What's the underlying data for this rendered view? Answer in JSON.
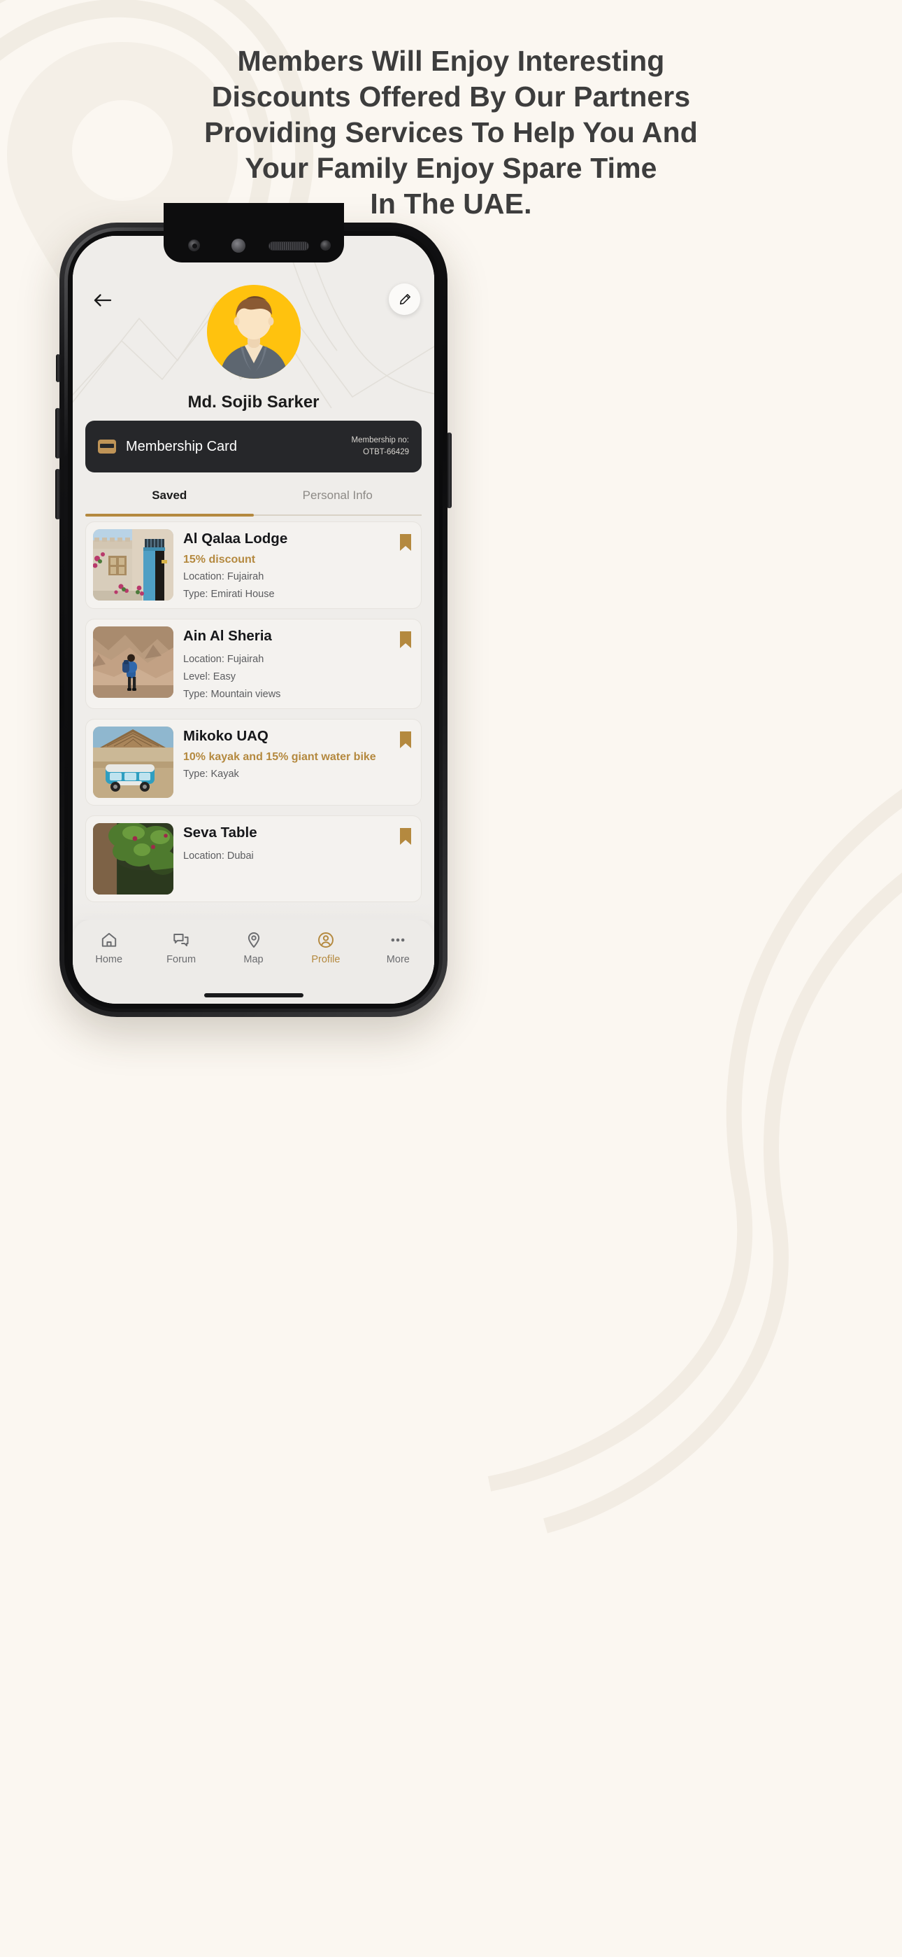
{
  "palette": {
    "page_bg": "#fbf7f1",
    "headline_color": "#3d3d3d",
    "accent_gold": "#b4893f",
    "avatar_yellow": "#FFC20E",
    "card_dark": "#26272a",
    "screen_bg": "#efedea"
  },
  "headline": {
    "lines": [
      "Members Will Enjoy Interesting",
      "Discounts Offered By Our Partners",
      "Providing Services To Help You And",
      "Your Family Enjoy Spare Time",
      "In The UAE."
    ]
  },
  "phone": {
    "topbar": {
      "back_icon": "arrow-left-icon",
      "edit_icon": "pencil-icon"
    },
    "profile": {
      "name": "Md. Sojib Sarker",
      "avatar_icon": "user-avatar"
    },
    "membership": {
      "icon": "credit-card-icon",
      "label": "Membership Card",
      "number_label": "Membership no:",
      "number": "OTBT-66429"
    },
    "tabs": [
      {
        "label": "Saved",
        "active": true
      },
      {
        "label": "Personal Info",
        "active": false
      }
    ],
    "saved_items": [
      {
        "title": "Al Qalaa Lodge",
        "discount": "15% discount",
        "meta": [
          "Location: Fujairah",
          "Type: Emirati House"
        ],
        "bookmark_icon": "bookmark-filled-icon",
        "thumb_alt": "emirati-house-blue-door"
      },
      {
        "title": "Ain Al Sheria",
        "discount": "",
        "meta": [
          "Location: Fujairah",
          "Level: Easy",
          "Type: Mountain views"
        ],
        "bookmark_icon": "bookmark-filled-icon",
        "thumb_alt": "hiker-mountain-trail"
      },
      {
        "title": "Mikoko UAQ",
        "discount": "10% kayak and 15% giant water bike",
        "meta": [
          "Type: Kayak"
        ],
        "bookmark_icon": "bookmark-filled-icon",
        "thumb_alt": "blue-van-beach-hut"
      },
      {
        "title": "Seva Table",
        "discount": "",
        "meta": [
          "Location: Dubai"
        ],
        "bookmark_icon": "bookmark-filled-icon",
        "thumb_alt": "green-garden-foliage"
      }
    ],
    "bottom_nav": [
      {
        "label": "Home",
        "icon": "home-icon",
        "active": false
      },
      {
        "label": "Forum",
        "icon": "forum-icon",
        "active": false
      },
      {
        "label": "Map",
        "icon": "map-pin-icon",
        "active": false
      },
      {
        "label": "Profile",
        "icon": "profile-icon",
        "active": true
      },
      {
        "label": "More",
        "icon": "more-dots-icon",
        "active": false
      }
    ]
  }
}
